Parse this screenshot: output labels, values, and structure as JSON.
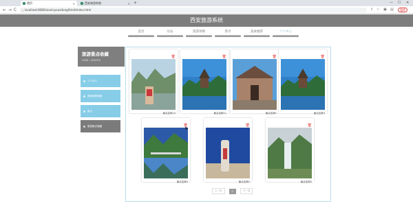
{
  "browser": {
    "tabs": [
      {
        "title": "首页",
        "active": true
      },
      {
        "title": "西安旅游系统",
        "active": false
      }
    ],
    "new_tab": "+",
    "back": "←",
    "forward": "→",
    "reload": "C",
    "url": "localhost:8080/xianlvyouxitong/front/index.html",
    "user_chip": "暂停",
    "window_controls": [
      "—",
      "☐",
      "✕"
    ]
  },
  "site": {
    "title": "西安旅游系统",
    "nav": [
      {
        "label": "首页",
        "active": false
      },
      {
        "label": "论坛",
        "active": false
      },
      {
        "label": "旅游攻略",
        "active": false
      },
      {
        "label": "景点",
        "active": false
      },
      {
        "label": "美食推荐",
        "active": false
      },
      {
        "label": "个人中心",
        "active": true
      }
    ]
  },
  "sidebar": {
    "title": "旅游景点收藏",
    "subtitle": "USER / CENTER",
    "items": [
      {
        "label": "个人中心",
        "active": false
      },
      {
        "label": "美食推荐收藏",
        "active": false
      },
      {
        "label": "景点",
        "active": false
      },
      {
        "label": "旅游景点收藏",
        "active": true
      }
    ]
  },
  "cards": [
    {
      "label": "景点名称14",
      "trash_icon": "trash-icon"
    },
    {
      "label": "景点名称11",
      "trash_icon": "trash-icon"
    },
    {
      "label": "景点名称1",
      "trash_icon": "trash-icon"
    },
    {
      "label": "景点名称3",
      "trash_icon": "trash-icon"
    },
    {
      "label": "景点名称4",
      "trash_icon": "trash-icon"
    },
    {
      "label": "景点名称2",
      "trash_icon": "trash-icon"
    },
    {
      "label": "景点名称5",
      "trash_icon": "trash-icon"
    }
  ],
  "pagination": {
    "prev": "上一页",
    "current": "1",
    "next": "下一页"
  },
  "colors": {
    "header_gray": "#7d7d7d",
    "sidebar_blue": "#87cde8",
    "sidebar_active": "#7b7b7b",
    "panel_border": "#b5dde6",
    "trash_red": "#e34a4a"
  }
}
